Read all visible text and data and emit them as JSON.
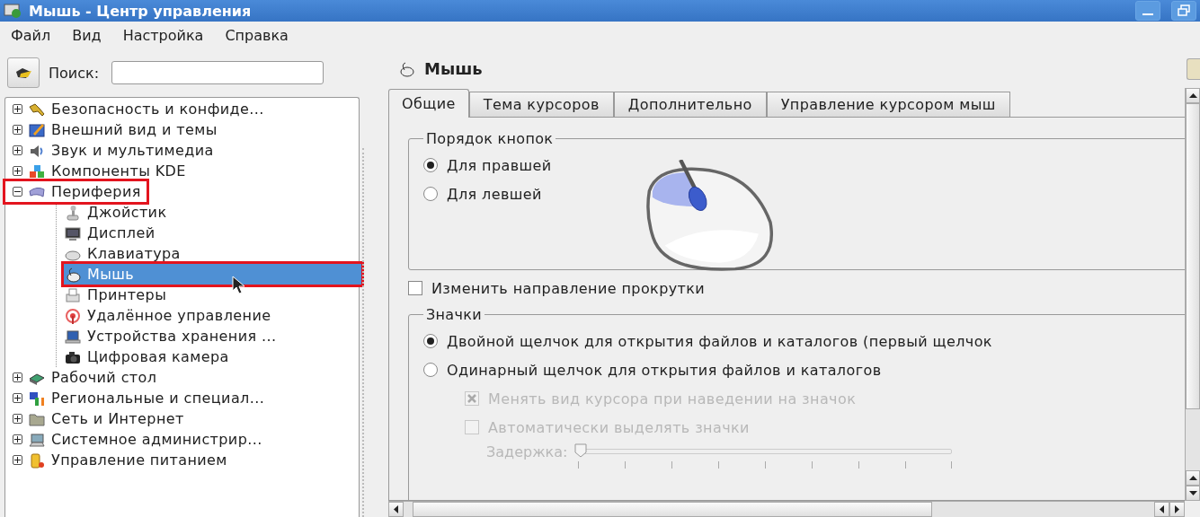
{
  "window": {
    "title": "Мышь - Центр управления"
  },
  "menu": [
    "Файл",
    "Вид",
    "Настройка",
    "Справка"
  ],
  "search": {
    "label": "Поиск:"
  },
  "tree": [
    {
      "label": "Безопасность и конфиде...",
      "kind": "keys",
      "expanded": false,
      "selected": false,
      "annotated": false
    },
    {
      "label": "Внешний вид и темы",
      "kind": "paint",
      "expanded": false,
      "selected": false,
      "annotated": false
    },
    {
      "label": "Звук и мультимедиа",
      "kind": "speaker",
      "expanded": false,
      "selected": false,
      "annotated": false
    },
    {
      "label": "Компоненты KDE",
      "kind": "blocks",
      "expanded": false,
      "selected": false,
      "annotated": false
    },
    {
      "label": "Периферия",
      "kind": "device",
      "expanded": true,
      "selected": false,
      "annotated": true,
      "children": [
        {
          "label": "Джойстик",
          "kind": "joystick",
          "selected": false,
          "annotated": false
        },
        {
          "label": "Дисплей",
          "kind": "monitor",
          "selected": false,
          "annotated": false
        },
        {
          "label": "Клавиатура",
          "kind": "keyboard",
          "selected": false,
          "annotated": false
        },
        {
          "label": "Мышь",
          "kind": "mouse",
          "selected": true,
          "annotated": true
        },
        {
          "label": "Принтеры",
          "kind": "printer",
          "selected": false,
          "annotated": false
        },
        {
          "label": "Удалённое управление",
          "kind": "signal",
          "selected": false,
          "annotated": false
        },
        {
          "label": "Устройства хранения ...",
          "kind": "laptop",
          "selected": false,
          "annotated": false
        },
        {
          "label": "Цифровая камера",
          "kind": "camera",
          "selected": false,
          "annotated": false
        }
      ]
    },
    {
      "label": "Рабочий стол",
      "kind": "desk",
      "expanded": false,
      "selected": false,
      "annotated": false
    },
    {
      "label": "Региональные и специал...",
      "kind": "flag",
      "expanded": false,
      "selected": false,
      "annotated": false
    },
    {
      "label": "Сеть и Интернет",
      "kind": "folder",
      "expanded": false,
      "selected": false,
      "annotated": false
    },
    {
      "label": "Системное администрир...",
      "kind": "computer",
      "expanded": false,
      "selected": false,
      "annotated": false
    },
    {
      "label": "Управление питанием",
      "kind": "battery",
      "expanded": false,
      "selected": false,
      "annotated": false
    }
  ],
  "panel": {
    "title": "Мышь",
    "tabs": [
      {
        "label": "Общие",
        "selected": true
      },
      {
        "label": "Тема курсоров",
        "selected": false
      },
      {
        "label": "Дополнительно",
        "selected": false
      },
      {
        "label": "Управление курсором мыш",
        "selected": false
      }
    ],
    "button_order": {
      "title": "Порядок кнопок",
      "options": [
        {
          "label": "Для правшей",
          "selected": true
        },
        {
          "label": "Для левшей",
          "selected": false
        }
      ]
    },
    "reverse_scroll": {
      "label": "Изменить направление прокрутки",
      "checked": false
    },
    "icons": {
      "title": "Значки",
      "options": [
        {
          "label": "Двойной щелчок для открытия файлов и каталогов (первый щелчок",
          "selected": true
        },
        {
          "label": "Одинарный щелчок для открытия файлов и каталогов",
          "selected": false
        }
      ],
      "suboptions": [
        {
          "label": "Менять вид курсора при наведении на значок",
          "checked": true,
          "disabled": true
        },
        {
          "label": "Автоматически выделять значки",
          "checked": false,
          "disabled": true
        }
      ],
      "delay": {
        "label": "Задержка:",
        "level": 0,
        "disabled": true
      }
    }
  }
}
